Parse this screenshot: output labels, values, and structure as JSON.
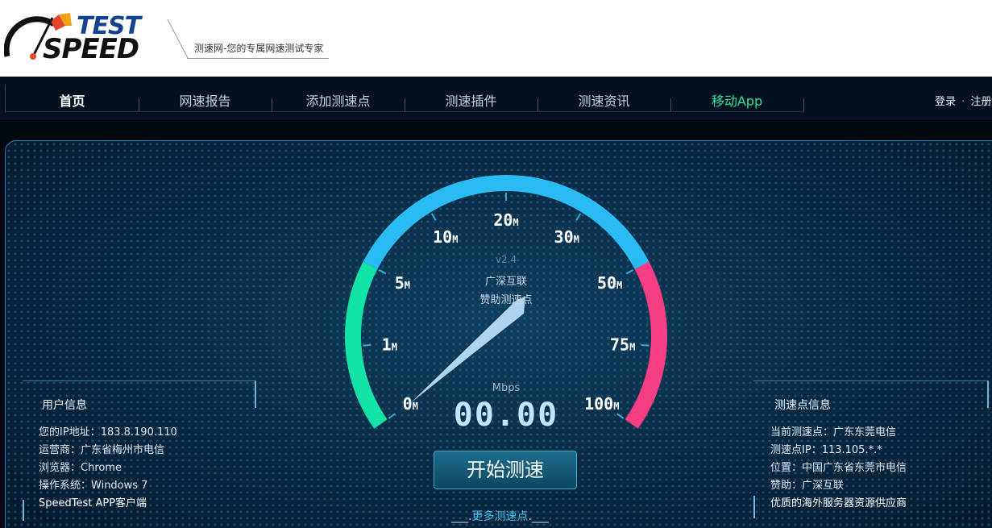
{
  "header": {
    "logo_top": "TEST",
    "logo_bottom": "SPEED",
    "slogan": "测速网-您的专属网速测试专家"
  },
  "nav": {
    "items": [
      "首页",
      "网速报告",
      "添加测速点",
      "测速插件",
      "测速资讯",
      "移动App"
    ],
    "login": "登录",
    "separator": "·",
    "register": "注册"
  },
  "gauge": {
    "version": "v2.4",
    "sponsor_line1": "广深互联",
    "sponsor_line2": "赞助测速点",
    "unit": "Mbps",
    "speed": "00.00",
    "tick_labels": [
      "0",
      "1",
      "5",
      "10",
      "20",
      "30",
      "50",
      "75",
      "100"
    ],
    "tick_unit": "M",
    "needle_value": 0,
    "colors": {
      "low": "#13e3a6",
      "mid": "#29bcf2",
      "high": "#f53e84"
    }
  },
  "user_info": {
    "title": "用户信息",
    "ip_label": "您的IP地址：",
    "ip": "183.8.190.110",
    "isp_label": "运营商：",
    "isp": "广东省梅州市电信",
    "browser_label": "浏览器：",
    "browser": "Chrome",
    "os_label": "操作系统：",
    "os": "Windows 7",
    "app_link": "SpeedTest APP客户端"
  },
  "server_info": {
    "title": "测速点信息",
    "current_label": "当前测速点：",
    "current": "广东东莞电信",
    "ip_label": "测速点IP：",
    "ip": "113.105.*.*",
    "location_label": "位置：",
    "location": "中国广东省东莞市电信",
    "sponsor_label": "赞助：",
    "sponsor": "广深互联",
    "ad": "优质的海外服务器资源供应商"
  },
  "actions": {
    "start": "开始测速",
    "more_prefix": "___.",
    "more": "更多测速点",
    "more_suffix": ".___"
  }
}
